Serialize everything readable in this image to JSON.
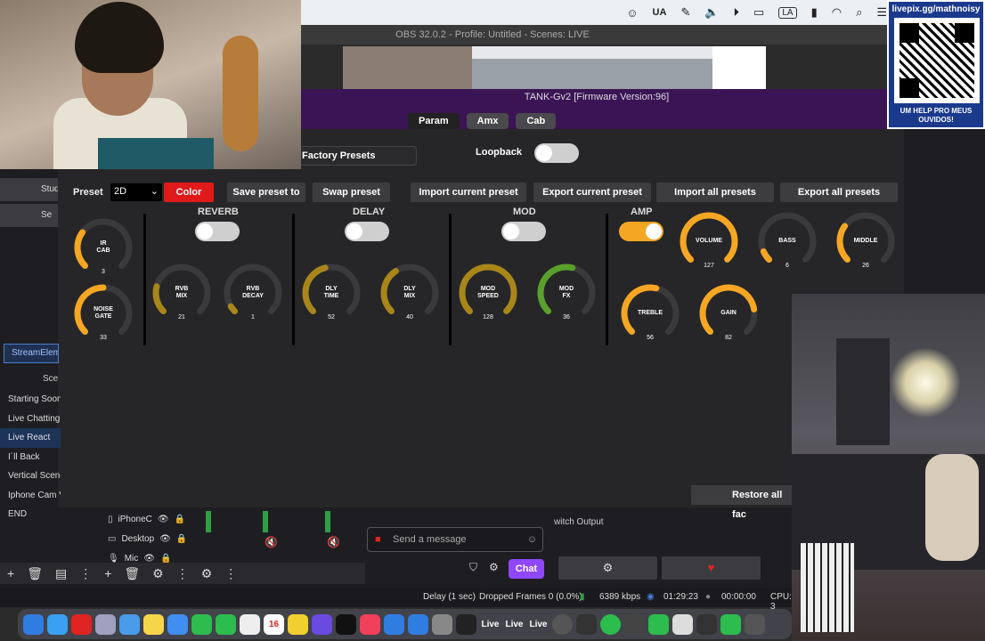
{
  "menubar": {
    "ua": "UA",
    "la": "LA"
  },
  "obs": {
    "title": "OBS 32.0.2 - Profile: Untitled - Scenes: LIVE"
  },
  "tank": {
    "title": "TANK-Gv2 [Firmware Version:96]",
    "tabs": [
      "Param",
      "Amx",
      "Cab"
    ],
    "factory_presets": "Factory Presets",
    "loopback": "Loopback",
    "preset_label": "Preset",
    "preset_value": "2D",
    "buttons": {
      "color": "Color",
      "save_to": "Save preset to",
      "swap": "Swap preset",
      "import_current": "Import current preset",
      "export_current": "Export current preset",
      "import_all": "Import all presets",
      "export_all": "Export all presets",
      "restore": "Restore all fac"
    },
    "sections": {
      "reverb": "REVERB",
      "delay": "DELAY",
      "mod": "MOD",
      "amp": "AMP"
    },
    "knobs": {
      "ir_cab": {
        "label1": "IR",
        "label2": "CAB",
        "value": "3",
        "pct": 0.3
      },
      "noise_gate": {
        "label1": "NOISE",
        "label2": "GATE",
        "value": "33",
        "pct": 0.5
      },
      "rvb_mix": {
        "label1": "RVB",
        "label2": "MIX",
        "value": "21",
        "pct": 0.22
      },
      "rvb_decay": {
        "label1": "RVB",
        "label2": "DECAY",
        "value": "1",
        "pct": 0.05
      },
      "dly_time": {
        "label1": "DLY",
        "label2": "TIME",
        "value": "52",
        "pct": 0.45
      },
      "dly_mix": {
        "label1": "DLY",
        "label2": "MIX",
        "value": "40",
        "pct": 0.38
      },
      "mod_speed": {
        "label1": "MOD",
        "label2": "SPEED",
        "value": "128",
        "pct": 1.0
      },
      "mod_fx": {
        "label1": "MOD",
        "label2": "FX",
        "value": "36",
        "pct": 0.55
      },
      "volume": {
        "label1": "VOLUME",
        "label2": "",
        "value": "127",
        "pct": 1.0
      },
      "bass": {
        "label1": "BASS",
        "label2": "",
        "value": "6",
        "pct": 0.08
      },
      "middle": {
        "label1": "MIDDLE",
        "label2": "",
        "value": "26",
        "pct": 0.3
      },
      "treble": {
        "label1": "TREBLE",
        "label2": "",
        "value": "56",
        "pct": 0.55
      },
      "gain": {
        "label1": "GAIN",
        "label2": "",
        "value": "82",
        "pct": 0.8
      }
    }
  },
  "overlay": {
    "qr_url": "livepix.gg/mathnoisy",
    "qr_help": "UM HELP PRO MEUS OUVIDOS!"
  },
  "dock_left": {
    "studio": "Studio",
    "settings": "Se",
    "stream_elements": "StreamElements",
    "scenes_header": "Scenes",
    "scenes": [
      "Starting Soon",
      "Live Chatting",
      "Live React",
      "I´ll Back",
      "Vertical Scene",
      "Iphone Cam V",
      "END"
    ],
    "selected_scene": 2
  },
  "sources": [
    "iPhoneC",
    "Desktop",
    "Mic"
  ],
  "chat": {
    "placeholder": "Send a message",
    "button": "Chat"
  },
  "twitch_output": "witch Output",
  "status": {
    "delay": "Delay (1 sec)",
    "dropped": "Dropped Frames 0 (0.0%)",
    "kbps": "6389 kbps",
    "live_time": "01:29:23",
    "rec_time": "00:00:00",
    "cpu": "CPU: 3"
  },
  "dock": {
    "live1": "Live",
    "live2": "Live",
    "live3": "Live",
    "calendar_day": "16"
  },
  "colors": {
    "accent_orange": "#f5a623",
    "red": "#e01a1a",
    "twitch_purple": "#9147ff",
    "mod_green": "#5aa02c"
  }
}
